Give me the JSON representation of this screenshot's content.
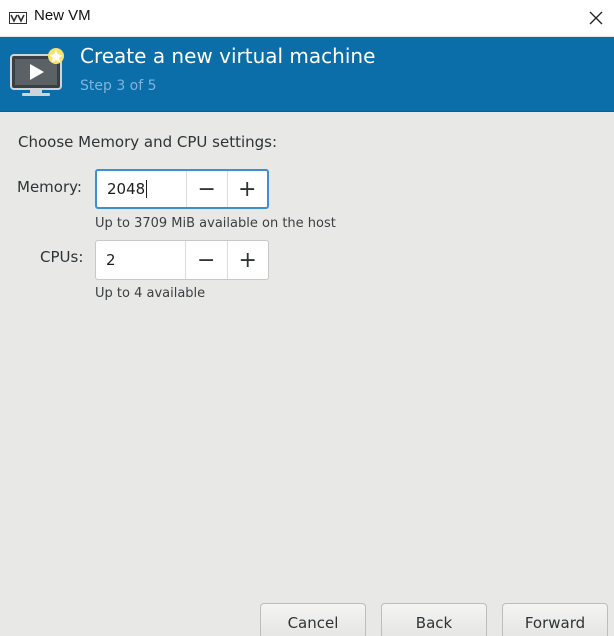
{
  "window": {
    "title": "New VM"
  },
  "header": {
    "title": "Create a new virtual machine",
    "step": "Step 3 of 5"
  },
  "main": {
    "prompt": "Choose Memory and CPU settings:",
    "memory": {
      "label": "Memory:",
      "value": "2048",
      "hint": "Up to 3709 MiB available on the host"
    },
    "cpus": {
      "label": "CPUs:",
      "value": "2",
      "hint": "Up to 4 available"
    },
    "decrement_glyph": "−",
    "increment_glyph": "+"
  },
  "footer": {
    "cancel_label": "Cancel",
    "back_label": "Back",
    "forward_label": "Forward"
  },
  "icons": {
    "app": "virt-manager-icon",
    "close": "close-icon",
    "header": "new-vm-monitor-icon"
  },
  "colors": {
    "header_bg": "#0b6ea8",
    "header_step": "#7fb4dd",
    "window_bg": "#e8e8e7",
    "focus_ring": "#3d8fd1"
  }
}
